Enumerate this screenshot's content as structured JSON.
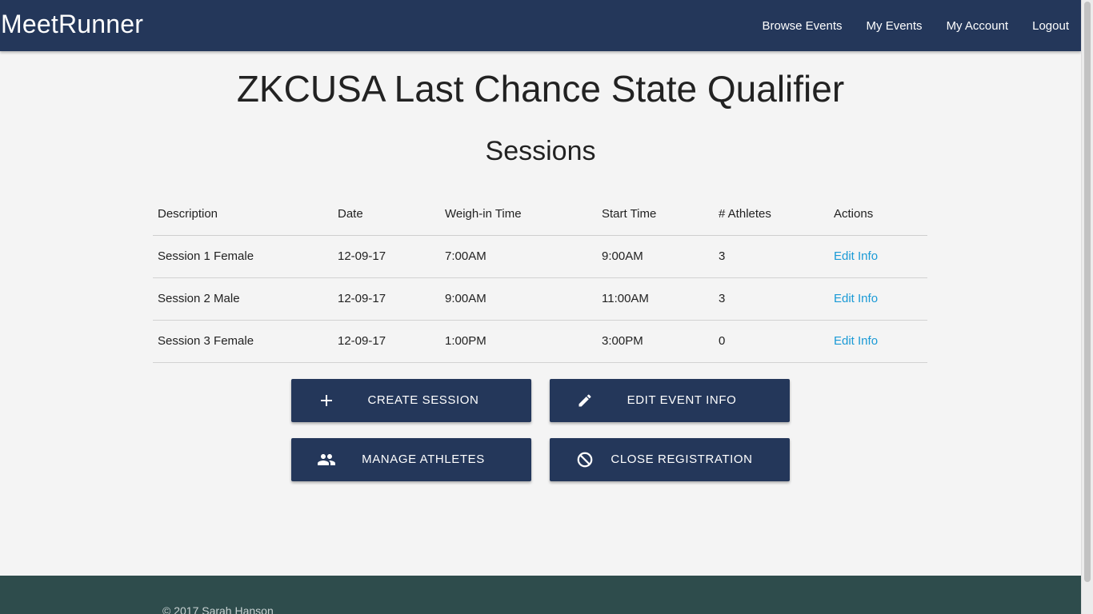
{
  "navbar": {
    "brand": "MeetRunner",
    "links": [
      "Browse Events",
      "My Events",
      "My Account",
      "Logout"
    ]
  },
  "event": {
    "title": "ZKCUSA Last Chance State Qualifier"
  },
  "sessions": {
    "heading": "Sessions",
    "columns": [
      "Description",
      "Date",
      "Weigh-in Time",
      "Start Time",
      "# Athletes",
      "Actions"
    ],
    "rows": [
      {
        "description": "Session 1 Female",
        "date": "12-09-17",
        "weigh_in": "7:00AM",
        "start": "9:00AM",
        "athletes": "3",
        "action": "Edit Info"
      },
      {
        "description": "Session 2 Male",
        "date": "12-09-17",
        "weigh_in": "9:00AM",
        "start": "11:00AM",
        "athletes": "3",
        "action": "Edit Info"
      },
      {
        "description": "Session 3 Female",
        "date": "12-09-17",
        "weigh_in": "1:00PM",
        "start": "3:00PM",
        "athletes": "0",
        "action": "Edit Info"
      }
    ]
  },
  "buttons": {
    "create_session": {
      "label": "CREATE SESSION",
      "icon": "plus-icon"
    },
    "edit_event": {
      "label": "EDIT EVENT INFO",
      "icon": "pencil-icon"
    },
    "manage_athletes": {
      "label": "MANAGE ATHLETES",
      "icon": "people-icon"
    },
    "close_registration": {
      "label": "CLOSE REGISTRATION",
      "icon": "block-icon"
    }
  },
  "footer": {
    "copyright": "© 2017 Sarah Hanson"
  },
  "colors": {
    "navbar": "#24375a",
    "button": "#24375a",
    "link": "#1a9ad6",
    "footer": "#2e4c4c",
    "background": "#f4f4f4"
  }
}
